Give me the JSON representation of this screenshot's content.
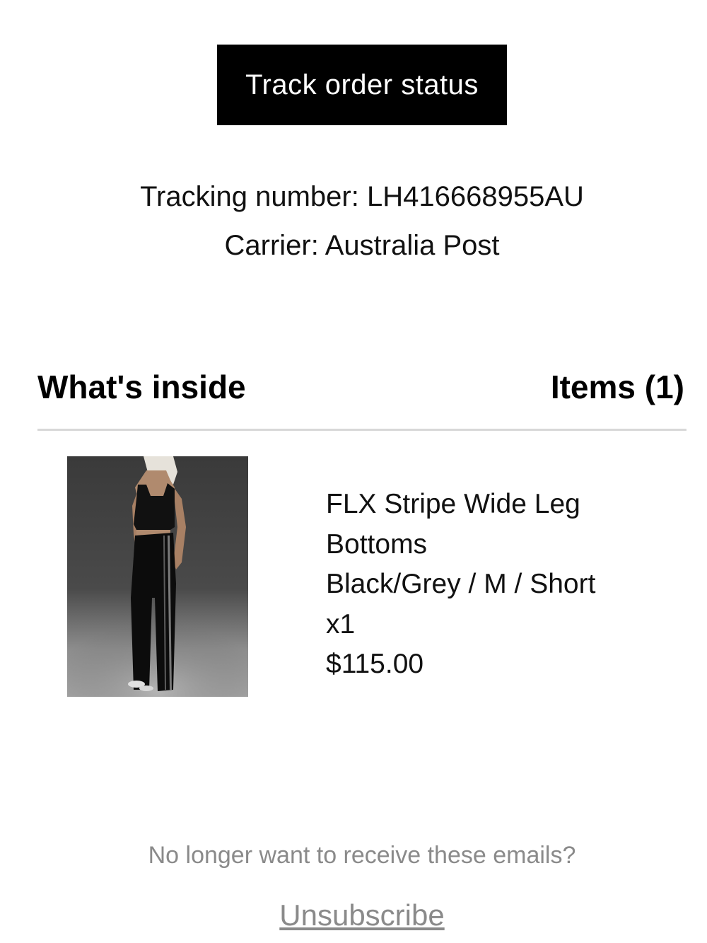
{
  "track_button": {
    "label": "Track order status"
  },
  "shipment": {
    "tracking_line": "Tracking number: LH416668955AU",
    "carrier_line": "Carrier: Australia Post"
  },
  "contents": {
    "heading": "What's inside",
    "items_count": "Items (1)"
  },
  "product": {
    "image_name": "product-photo",
    "title": "FLX Stripe Wide Leg Bottoms",
    "variant": "Black/Grey / M / Short",
    "quantity": "x1",
    "price": "$115.00"
  },
  "footer": {
    "question": "No longer want to receive these emails?",
    "unsubscribe_label": "Unsubscribe"
  },
  "colors": {
    "button_bg": "#000000",
    "button_text": "#ffffff",
    "muted_text": "#8a8a8a",
    "divider": "#d8d8d8"
  }
}
